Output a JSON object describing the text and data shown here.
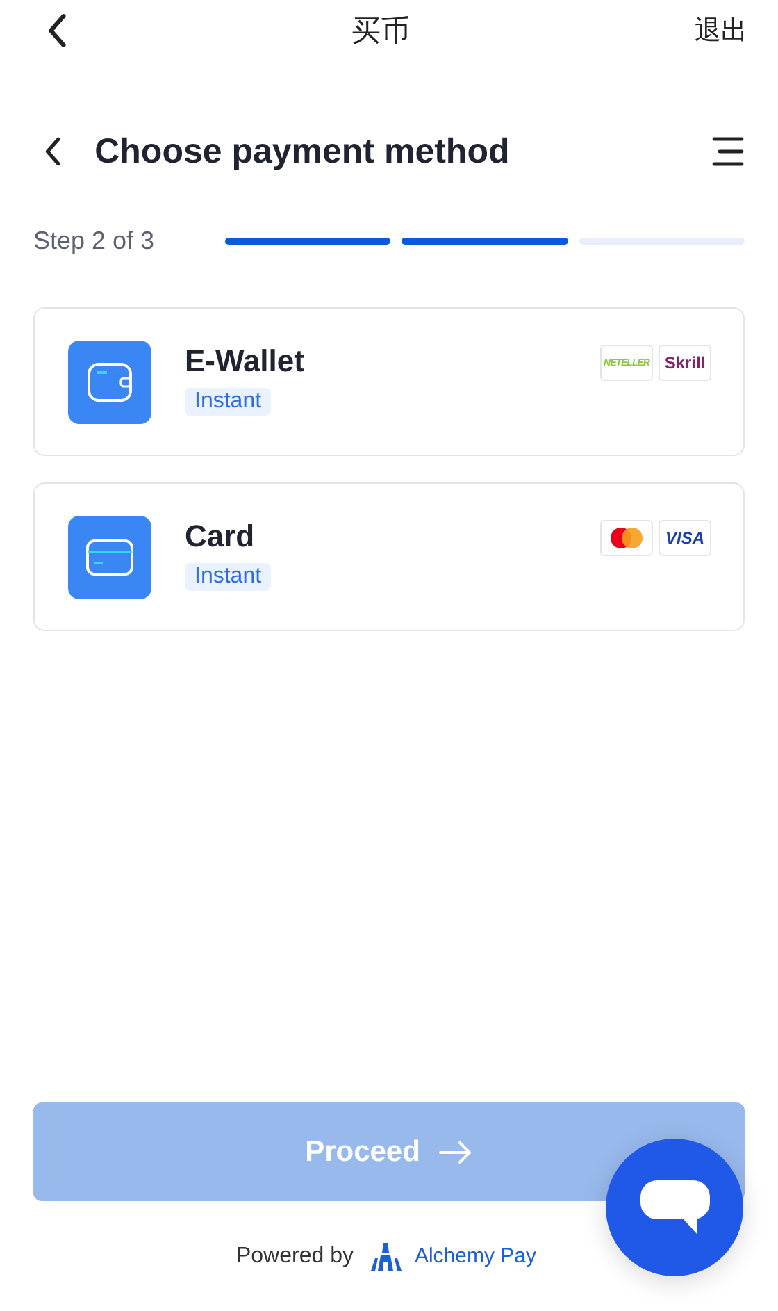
{
  "top_bar": {
    "title": "买币",
    "action": "退出"
  },
  "header": {
    "title": "Choose payment method"
  },
  "progress": {
    "label": "Step 2 of 3",
    "segments": [
      {
        "filled": true
      },
      {
        "filled": true
      },
      {
        "filled": false
      }
    ]
  },
  "methods": [
    {
      "kind": "wallet",
      "name": "E-Wallet",
      "tag": "Instant",
      "logos": [
        {
          "kind": "neteller",
          "text": "NETELLER"
        },
        {
          "kind": "skrill",
          "text": "Skrill"
        }
      ]
    },
    {
      "kind": "card",
      "name": "Card",
      "tag": "Instant",
      "logos": [
        {
          "kind": "mastercard"
        },
        {
          "kind": "visa",
          "text": "VISA"
        }
      ]
    }
  ],
  "proceed": {
    "label": "Proceed",
    "disabled": true
  },
  "footer": {
    "text": "Powered by",
    "brand": "Alchemy Pay"
  }
}
